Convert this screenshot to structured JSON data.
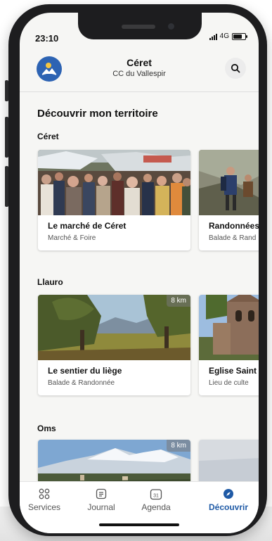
{
  "status": {
    "time": "23:10",
    "network": "4G",
    "battery_level": 0.75
  },
  "header": {
    "title": "Céret",
    "subtitle": "CC du Vallespir"
  },
  "page": {
    "title": "Découvrir mon territoire"
  },
  "sections": [
    {
      "title": "Céret",
      "cards": [
        {
          "name": "Le marché de Céret",
          "category": "Marché & Foire",
          "distance": ""
        },
        {
          "name": "Randonnées",
          "category": "Balade & Rand",
          "distance": ""
        }
      ]
    },
    {
      "title": "Llauro",
      "cards": [
        {
          "name": "Le sentier du liège",
          "category": "Balade & Randonnée",
          "distance": "8 km"
        },
        {
          "name": "Eglise Saint",
          "category": "Lieu de culte",
          "distance": ""
        }
      ]
    },
    {
      "title": "Oms",
      "cards": [
        {
          "name": "",
          "category": "",
          "distance": "8 km"
        },
        {
          "name": "",
          "category": "",
          "distance": ""
        }
      ]
    }
  ],
  "tabs": [
    {
      "label": "Services",
      "icon": "grid-icon",
      "active": false
    },
    {
      "label": "Journal",
      "icon": "journal-icon",
      "active": false
    },
    {
      "label": "Agenda",
      "icon": "calendar-icon",
      "active": false,
      "badge": "31"
    },
    {
      "label": "Découvrir",
      "icon": "compass-icon",
      "active": true
    }
  ],
  "colors": {
    "accent": "#1f5aa6",
    "avatar_bg": "#2d63b3"
  }
}
